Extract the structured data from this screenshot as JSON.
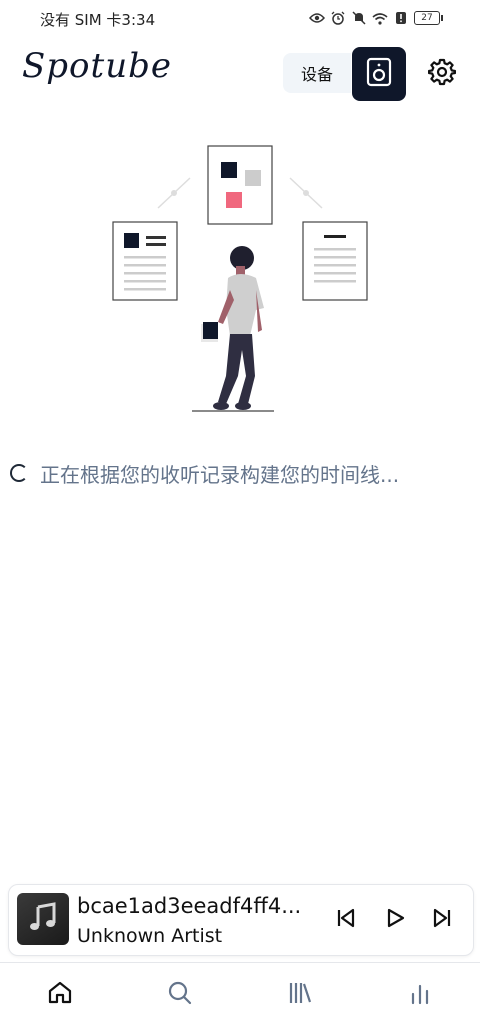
{
  "status_bar": {
    "left_text": "没有 SIM 卡3:34",
    "battery": "27"
  },
  "header": {
    "logo": "Spotube",
    "device_label": "设备"
  },
  "loading": {
    "text": "正在根据您的收听记录构建您的时间线..."
  },
  "player": {
    "title": "bcae1ad3eeadf4ff4...",
    "artist": "Unknown Artist"
  },
  "nav": {
    "items": [
      {
        "icon": "home-icon",
        "active": true
      },
      {
        "icon": "search-icon"
      },
      {
        "icon": "library-icon"
      },
      {
        "icon": "lyrics-icon"
      }
    ]
  },
  "colors": {
    "accent": "#0f172a",
    "illustration_accent": "#f0687e",
    "muted_text": "#64748b"
  }
}
